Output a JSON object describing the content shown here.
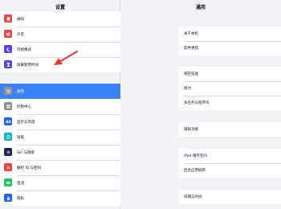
{
  "sidebar": {
    "title": "设置",
    "group1": [
      {
        "label": "通知",
        "icon": "bell-icon",
        "color": "#ef4444"
      },
      {
        "label": "声音",
        "icon": "speaker-icon",
        "color": "#ef4444"
      },
      {
        "label": "勿扰模式",
        "icon": "moon-icon",
        "color": "#4f46e5"
      },
      {
        "label": "屏幕使用时间",
        "icon": "hourglass-icon",
        "color": "#4f46e5"
      }
    ],
    "group2": [
      {
        "label": "通用",
        "icon": "gear-icon",
        "color": "#8e8e93",
        "active": true
      },
      {
        "label": "控制中心",
        "icon": "toggle-icon",
        "color": "#8e8e93"
      },
      {
        "label": "显示与亮度",
        "icon": "display-icon",
        "color": "#2563eb"
      },
      {
        "label": "墙纸",
        "icon": "flower-icon",
        "color": "#06b6d4"
      },
      {
        "label": "Siri 与搜索",
        "icon": "siri-icon",
        "color": "#1f2937"
      },
      {
        "label": "触控 ID 与密码",
        "icon": "fingerprint-icon",
        "color": "#ef4444"
      },
      {
        "label": "电池",
        "icon": "battery-icon",
        "color": "#22c55e"
      },
      {
        "label": "隐私",
        "icon": "hand-icon",
        "color": "#2563eb"
      }
    ]
  },
  "main": {
    "title": "通用",
    "group1": [
      "关于本机",
      "软件更新"
    ],
    "group2": [
      "隔空投送",
      "接力",
      "多任务与程序坞"
    ],
    "group3": [
      "辅助功能"
    ],
    "group4": [
      "iPad 储存空间",
      "后台应用刷新"
    ],
    "group5": [
      "日期与时间"
    ]
  },
  "colors": {
    "active": "#3b82f6",
    "annotation_arrow": "#e53935"
  }
}
